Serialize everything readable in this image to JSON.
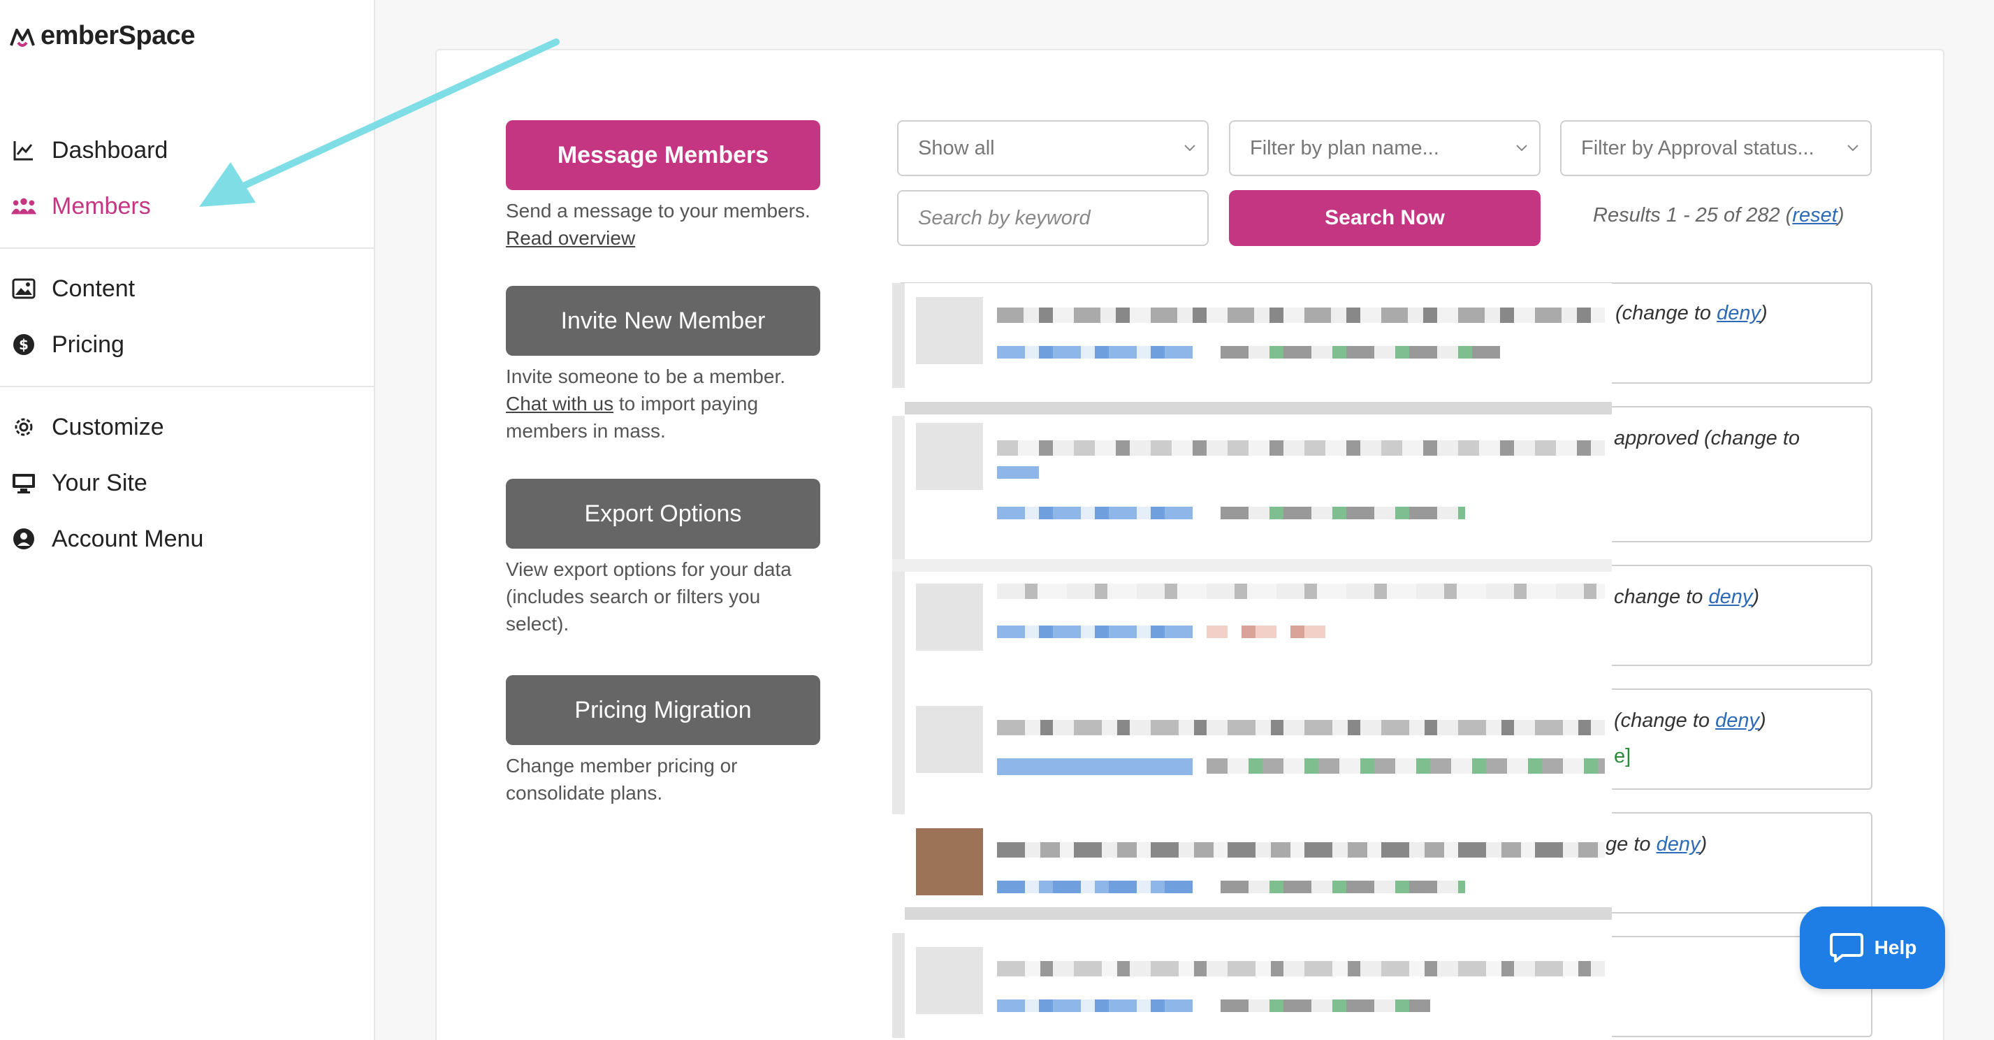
{
  "app": {
    "logo_text": "emberSpace",
    "logo_mark": "M"
  },
  "sidebar": {
    "items": [
      {
        "label": "Dashboard",
        "icon": "chart-line-icon"
      },
      {
        "label": "Members",
        "icon": "users-icon",
        "active": true
      },
      {
        "label": "Content",
        "icon": "image-icon"
      },
      {
        "label": "Pricing",
        "icon": "dollar-circle-icon"
      },
      {
        "label": "Customize",
        "icon": "gear-icon"
      },
      {
        "label": "Your Site",
        "icon": "monitor-icon"
      },
      {
        "label": "Account Menu",
        "icon": "user-circle-icon"
      }
    ]
  },
  "actions": {
    "message": {
      "label": "Message Members",
      "desc_text": "Send a message to your members.",
      "desc_link": "Read overview"
    },
    "invite": {
      "label": "Invite New Member",
      "desc_text": "Invite someone to be a member.",
      "desc_link": "Chat with us",
      "desc_after": "to import paying members in mass."
    },
    "export": {
      "label": "Export Options",
      "desc_text": "View export options for your data (includes search or filters you select)."
    },
    "migration": {
      "label": "Pricing Migration",
      "desc_text": "Change member pricing or consolidate plans."
    }
  },
  "filters": {
    "show": "Show all",
    "plan_placeholder": "Filter by plan name...",
    "approval_placeholder": "Filter by Approval status...",
    "keyword_placeholder": "Search by keyword",
    "search_button": "Search Now",
    "results_text": "Results 1 - 25 of 282 (",
    "reset_link": "reset",
    "results_close": ")"
  },
  "rows": [
    {
      "pre": "(change to ",
      "link": "deny",
      "post": ")"
    },
    {
      "pre": "approved (change to",
      "link": "",
      "post": ""
    },
    {
      "pre": "change to ",
      "link": "deny",
      "post": ")"
    },
    {
      "pre": "(change to ",
      "link": "deny",
      "post": ")",
      "extra": "e]"
    },
    {
      "pre": "ge to ",
      "link": "deny",
      "post": ")"
    },
    {
      "pre": "",
      "link": "",
      "post": ""
    }
  ],
  "help": {
    "label": "Help",
    "icon": "chat-bubble-icon"
  },
  "colors": {
    "accent": "#c53682",
    "gray_button": "#666666",
    "link": "#2d6bb8",
    "help": "#1e7ee6",
    "arrow": "#7fdde6"
  }
}
